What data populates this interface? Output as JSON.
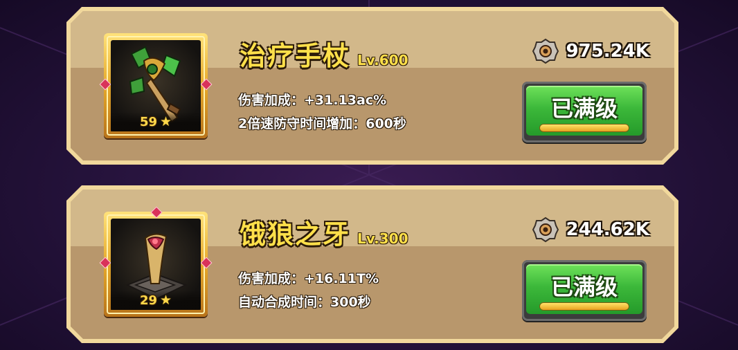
{
  "items": [
    {
      "name": "治疗手杖",
      "level": "Lv.600",
      "stars": "59",
      "cost": "975.24K",
      "cost_icon": "gear-nut-icon",
      "stats": [
        "伤害加成：+31.13ac%",
        "2倍速防守时间增加：600秒"
      ],
      "button_label": "已满级",
      "icon": "healing-staff-icon"
    },
    {
      "name": "饿狼之牙",
      "level": "Lv.300",
      "stars": "29",
      "cost": "244.62K",
      "cost_icon": "gear-nut-icon",
      "stats": [
        "伤害加成：+16.11T%",
        "自动合成时间：300秒"
      ],
      "button_label": "已满级",
      "icon": "wolf-fang-icon"
    }
  ],
  "colors": {
    "title": "#ffe04a",
    "card_light": "#d2b88a",
    "card_dark": "#b8976c",
    "button_green": "#3cb83a",
    "background": "#24123a"
  }
}
